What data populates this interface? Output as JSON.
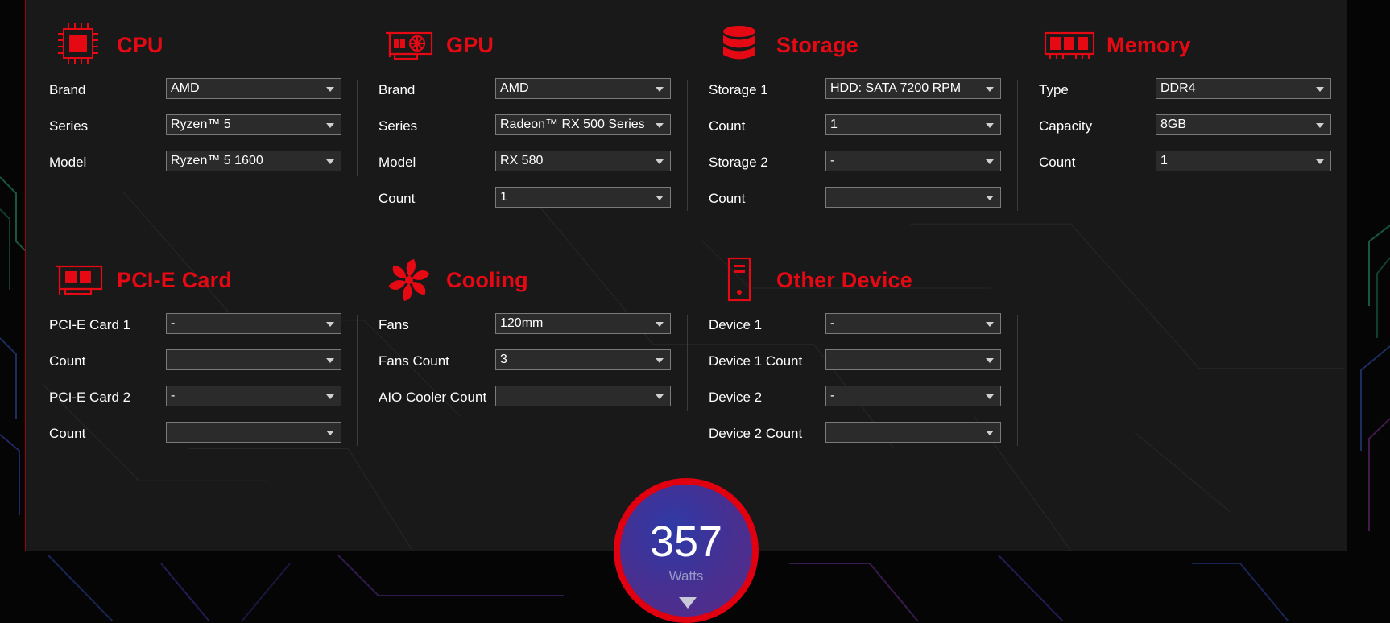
{
  "colors": {
    "accent": "#e50914",
    "panel": "#1a1a1a",
    "field": "#2b2b2b",
    "text": "#ffffff"
  },
  "sections": {
    "cpu": {
      "title": "CPU",
      "icon": "cpu-chip-icon",
      "rows": [
        {
          "label": "Brand",
          "value": "AMD"
        },
        {
          "label": "Series",
          "value": "Ryzen™ 5"
        },
        {
          "label": "Model",
          "value": "Ryzen™ 5 1600"
        }
      ]
    },
    "gpu": {
      "title": "GPU",
      "icon": "graphics-card-icon",
      "rows": [
        {
          "label": "Brand",
          "value": "AMD"
        },
        {
          "label": "Series",
          "value": "Radeon™ RX 500 Series"
        },
        {
          "label": "Model",
          "value": "RX 580"
        },
        {
          "label": "Count",
          "value": "1"
        }
      ]
    },
    "storage": {
      "title": "Storage",
      "icon": "database-icon",
      "rows": [
        {
          "label": "Storage 1",
          "value": "HDD: SATA 7200 RPM"
        },
        {
          "label": "Count",
          "value": "1"
        },
        {
          "label": "Storage 2",
          "value": "-"
        },
        {
          "label": "Count",
          "value": ""
        }
      ]
    },
    "memory": {
      "title": "Memory",
      "icon": "ram-module-icon",
      "rows": [
        {
          "label": "Type",
          "value": "DDR4"
        },
        {
          "label": "Capacity",
          "value": "8GB"
        },
        {
          "label": "Count",
          "value": "1"
        }
      ]
    },
    "pcie": {
      "title": "PCI-E Card",
      "icon": "pcie-card-icon",
      "rows": [
        {
          "label": "PCI-E Card 1",
          "value": "-"
        },
        {
          "label": "Count",
          "value": ""
        },
        {
          "label": "PCI-E Card 2",
          "value": "-"
        },
        {
          "label": "Count",
          "value": ""
        }
      ]
    },
    "cooling": {
      "title": "Cooling",
      "icon": "fan-icon",
      "rows": [
        {
          "label": "Fans",
          "value": "120mm"
        },
        {
          "label": "Fans Count",
          "value": "3"
        },
        {
          "label": "AIO Cooler Count",
          "value": ""
        }
      ]
    },
    "other": {
      "title": "Other Device",
      "icon": "pc-tower-icon",
      "rows": [
        {
          "label": "Device 1",
          "value": "-"
        },
        {
          "label": "Device 1 Count",
          "value": ""
        },
        {
          "label": "Device 2",
          "value": "-"
        },
        {
          "label": "Device 2 Count",
          "value": ""
        }
      ]
    }
  },
  "wattage": {
    "value": "357",
    "unit": "Watts",
    "arrow_icon": "triangle-down-icon"
  }
}
